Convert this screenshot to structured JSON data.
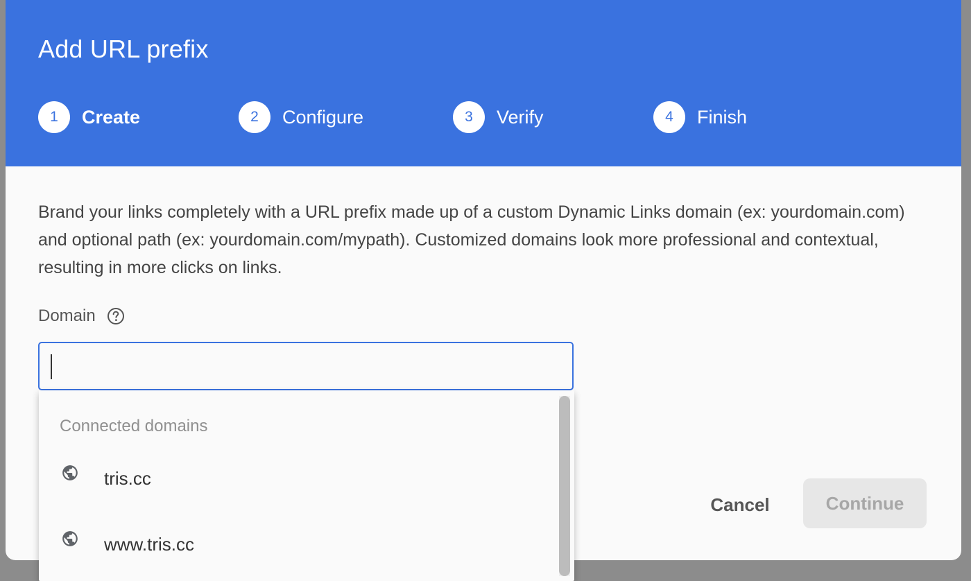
{
  "dialog": {
    "title": "Add URL prefix",
    "steps": [
      {
        "number": "1",
        "label": "Create",
        "active": true
      },
      {
        "number": "2",
        "label": "Configure",
        "active": false
      },
      {
        "number": "3",
        "label": "Verify",
        "active": false
      },
      {
        "number": "4",
        "label": "Finish",
        "active": false
      }
    ],
    "description": "Brand your links completely with a URL prefix made up of a custom Dynamic Links domain (ex: yourdomain.com) and optional path (ex: yourdomain.com/mypath). Customized domains look more professional and contextual, resulting in more clicks on links.",
    "field": {
      "label": "Domain",
      "value": "",
      "help_icon": "help-circle-icon"
    },
    "dropdown": {
      "header": "Connected domains",
      "options": [
        {
          "label": "tris.cc",
          "icon": "globe-icon"
        },
        {
          "label": "www.tris.cc",
          "icon": "globe-icon"
        }
      ]
    },
    "actions": {
      "cancel_label": "Cancel",
      "continue_label": "Continue"
    }
  },
  "colors": {
    "header_bg": "#3a72df",
    "input_focus_border": "#3a72df",
    "continue_disabled_bg": "#e7e7e7",
    "continue_disabled_text": "#a7a7a7"
  }
}
